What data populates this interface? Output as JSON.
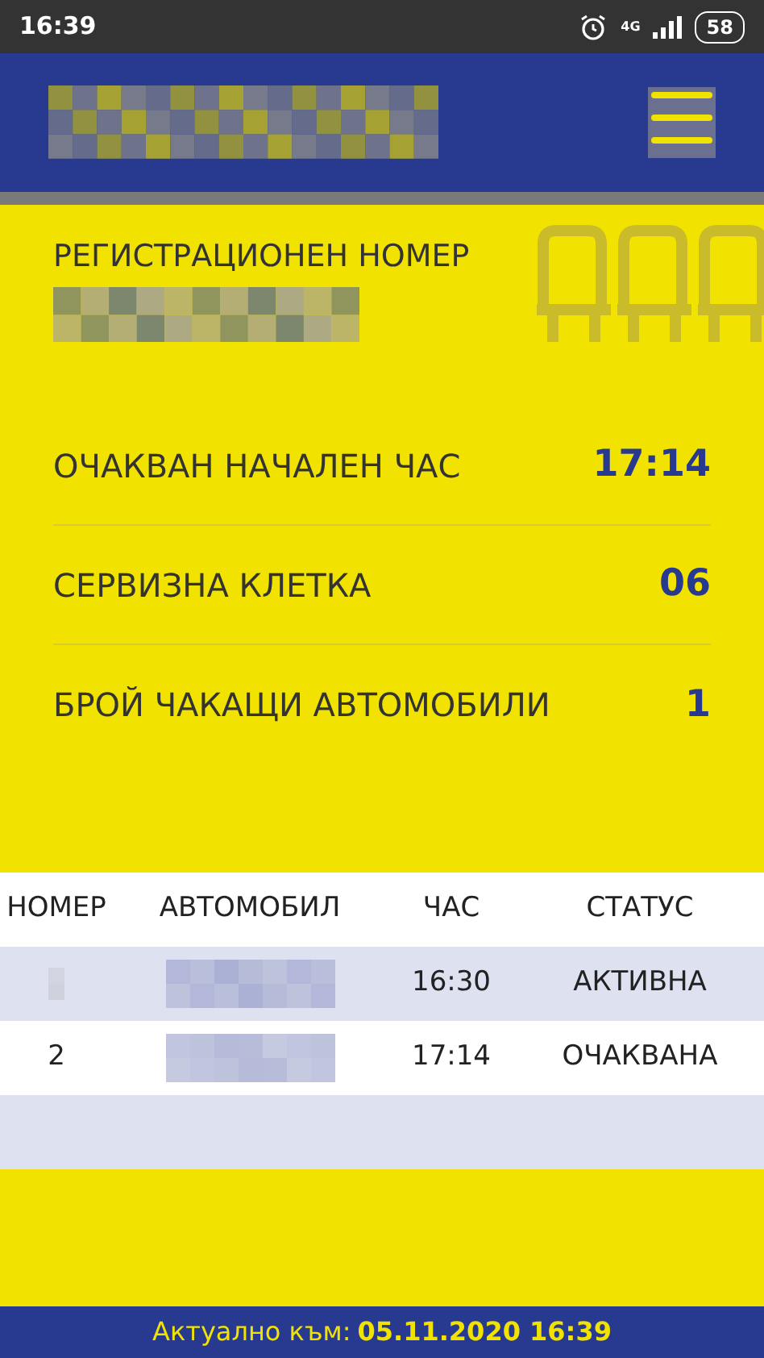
{
  "status_bar": {
    "time": "16:39",
    "network": "4G",
    "battery": "58"
  },
  "registration": {
    "label": "РЕГИСТРАЦИОНЕН НОМЕР"
  },
  "info_rows": [
    {
      "label": "ОЧАКВАН НАЧАЛЕН ЧАС",
      "value": "17:14"
    },
    {
      "label": "СЕРВИЗНА КЛЕТКА",
      "value": "06"
    },
    {
      "label": "БРОЙ ЧАКАЩИ АВТОМОБИЛИ",
      "value": "1"
    }
  ],
  "table": {
    "columns": [
      "НОМЕР",
      "АВТОМОБИЛ",
      "ЧАС",
      "СТАТУС"
    ],
    "rows": [
      {
        "time": "16:30",
        "status": "АКТИВНА"
      },
      {
        "number": "2",
        "time": "17:14",
        "status": "ОЧАКВАНА"
      }
    ]
  },
  "footer": {
    "label": "Актуално към:",
    "value": "05.11.2020 16:39"
  }
}
